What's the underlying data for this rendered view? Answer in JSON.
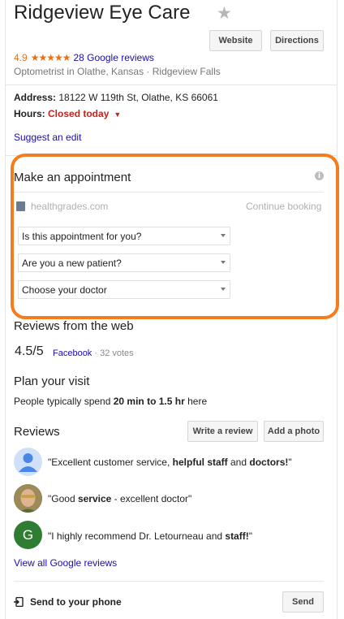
{
  "header": {
    "title": "Ridgeview Eye Care",
    "website_label": "Website",
    "directions_label": "Directions",
    "rating_value": "4.9",
    "stars_display": "★★★★★",
    "reviews_link": "28 Google reviews",
    "category": "Optometrist in Olathe, Kansas · Ridgeview Falls"
  },
  "info": {
    "address_label": "Address:",
    "address_value": "18122 W 119th St, Olathe, KS 66061",
    "hours_label": "Hours:",
    "hours_status": "Closed today",
    "suggest_edit": "Suggest an edit"
  },
  "appointment": {
    "title": "Make an appointment",
    "provider": "healthgrades.com",
    "continue_label": "Continue booking",
    "selects": [
      "Is this appointment for you?",
      "Are you a new patient?",
      "Choose your doctor"
    ]
  },
  "web_reviews": {
    "heading": "Reviews from the web",
    "score": "4.5/5",
    "source": "Facebook",
    "votes": " · 32 votes"
  },
  "plan": {
    "heading": "Plan your visit",
    "text_prefix": "People typically spend ",
    "text_bold": "20 min to 1.5 hr",
    "text_suffix": " here"
  },
  "reviews": {
    "heading": "Reviews",
    "write_label": "Write a review",
    "add_photo_label": "Add a photo",
    "items": [
      {
        "p1": "\"Excellent customer service, ",
        "b1": "helpful staff",
        "p2": " and ",
        "b2": "doctors!",
        "p3": "\""
      },
      {
        "p1": "\"Good ",
        "b1": "service",
        "p2": " - excellent doctor\"",
        "b2": "",
        "p3": ""
      },
      {
        "p1": "\"I highly recommend Dr. Letourneau and ",
        "b1": "staff!",
        "p2": "\"",
        "b2": "",
        "p3": "",
        "avatar_letter": "G"
      }
    ],
    "view_all": "View all Google reviews"
  },
  "send": {
    "label": "Send to your phone",
    "button": "Send"
  },
  "colors": {
    "orange_highlight": "#f57c1f",
    "rating_orange": "#e7711b",
    "link_blue": "#1a0dab",
    "closed_red": "#c5221f"
  }
}
